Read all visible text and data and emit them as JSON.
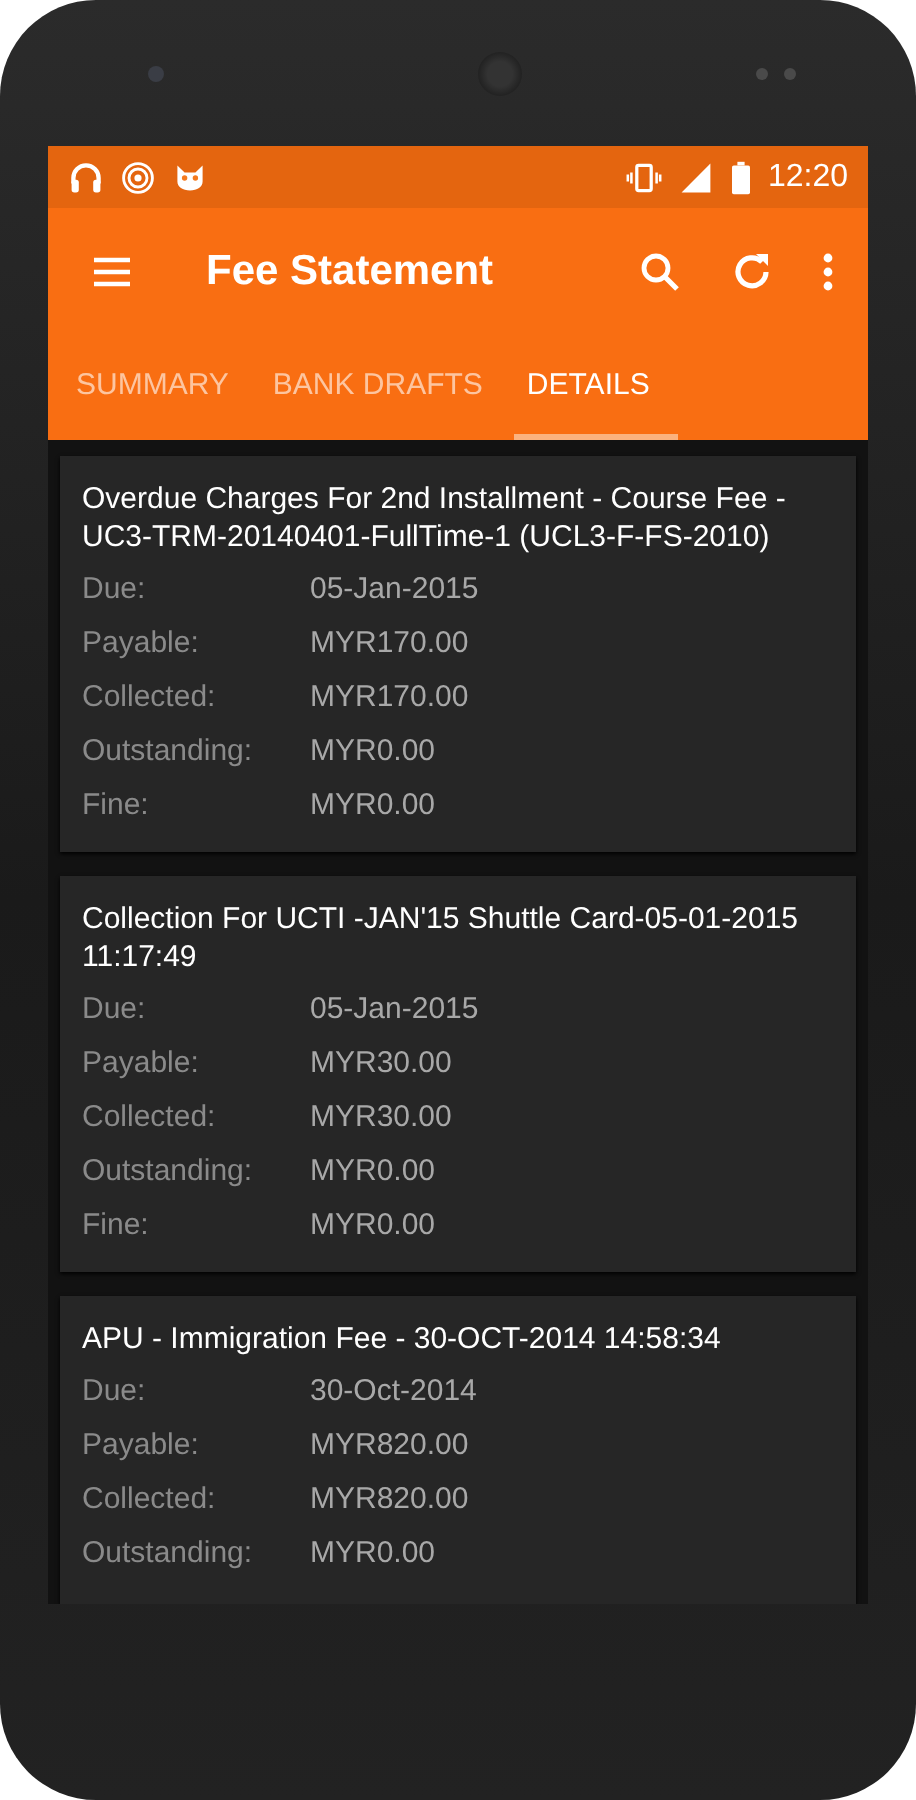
{
  "status_bar": {
    "time": "12:20"
  },
  "toolbar": {
    "title": "Fee Statement"
  },
  "tabs": [
    {
      "label": "SUMMARY",
      "selected": false
    },
    {
      "label": "BANK DRAFTS",
      "selected": false
    },
    {
      "label": "DETAILS",
      "selected": true
    }
  ],
  "cards": [
    {
      "title": "Overdue Charges For 2nd Installment - Course Fee - UC3-TRM-20140401-FullTime-1 (UCL3-F-FS-2010)",
      "fields": [
        {
          "label": "Due:",
          "value": "05-Jan-2015"
        },
        {
          "label": "Payable:",
          "value": "MYR170.00"
        },
        {
          "label": "Collected:",
          "value": "MYR170.00"
        },
        {
          "label": "Outstanding:",
          "value": "MYR0.00"
        },
        {
          "label": "Fine:",
          "value": "MYR0.00"
        }
      ]
    },
    {
      "title": "Collection For UCTI -JAN'15 Shuttle Card-05-01-2015 11:17:49",
      "fields": [
        {
          "label": "Due:",
          "value": "05-Jan-2015"
        },
        {
          "label": "Payable:",
          "value": "MYR30.00"
        },
        {
          "label": "Collected:",
          "value": "MYR30.00"
        },
        {
          "label": "Outstanding:",
          "value": "MYR0.00"
        },
        {
          "label": "Fine:",
          "value": "MYR0.00"
        }
      ]
    },
    {
      "title": "APU - Immigration Fee - 30-OCT-2014 14:58:34",
      "fields": [
        {
          "label": "Due:",
          "value": "30-Oct-2014"
        },
        {
          "label": "Payable:",
          "value": "MYR820.00"
        },
        {
          "label": "Collected:",
          "value": "MYR820.00"
        },
        {
          "label": "Outstanding:",
          "value": "MYR0.00"
        }
      ]
    }
  ]
}
